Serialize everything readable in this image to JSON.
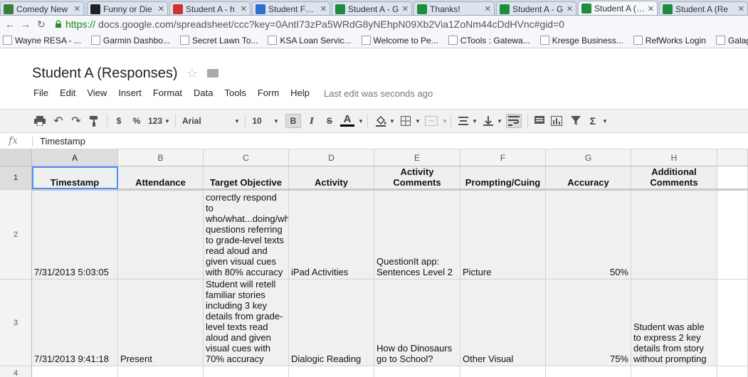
{
  "browser": {
    "tabs": [
      {
        "label": "Comedy New",
        "icon": "h-icon",
        "color": "#3a7d3a",
        "active": false
      },
      {
        "label": "Funny or Die",
        "icon": "funny-or-die-icon",
        "color": "#222222",
        "active": false
      },
      {
        "label": "Student A - h",
        "icon": "gmail-icon",
        "color": "#cc3333",
        "active": false
      },
      {
        "label": "Student Form",
        "icon": "drive-icon",
        "color": "#2f6fd1",
        "active": false
      },
      {
        "label": "Student A - G",
        "icon": "sheets-icon",
        "color": "#1e8e3e",
        "active": false
      },
      {
        "label": "Thanks!",
        "icon": "sheets-icon",
        "color": "#1e8e3e",
        "active": false
      },
      {
        "label": "Student A - G",
        "icon": "sheets-icon",
        "color": "#1e8e3e",
        "active": false
      },
      {
        "label": "Student A (Re",
        "icon": "sheets-icon",
        "color": "#1e8e3e",
        "active": true
      },
      {
        "label": "Student A (Re",
        "icon": "sheets-icon",
        "color": "#1e8e3e",
        "active": false
      }
    ],
    "url_scheme": "https://",
    "url_rest": "docs.google.com/spreadsheet/ccc?key=0AntI73zPa5WRdG8yNEhpN09Xb2Via1ZoNm44cDdHVnc#gid=0",
    "bookmarks": [
      "Wayne RESA - ...",
      "Garmin Dashbo...",
      "Secret Lawn To...",
      "KSA Loan Servic...",
      "Welcome to Pe...",
      "CTools : Gatewa...",
      "Kresge Business...",
      "RefWorks Login",
      "Galaga Game -"
    ]
  },
  "doc": {
    "title": "Student A (Responses)",
    "menu": [
      "File",
      "Edit",
      "View",
      "Insert",
      "Format",
      "Data",
      "Tools",
      "Form",
      "Help"
    ],
    "last_edit": "Last edit was seconds ago"
  },
  "toolbar": {
    "currency": "$",
    "percent": "%",
    "more_formats": "123",
    "font": "Arial",
    "font_size": "10",
    "bold": "B",
    "italic": "I",
    "strike": "S",
    "text_color": "A",
    "sigma": "Σ"
  },
  "formula_bar": {
    "fx": "fx",
    "value": "Timestamp"
  },
  "sheet": {
    "columns": [
      "A",
      "B",
      "C",
      "D",
      "E",
      "F",
      "G",
      "H"
    ],
    "row_numbers": [
      "1",
      "2",
      "3",
      "4"
    ],
    "header": [
      "Timestamp",
      "Attendance",
      "Target Objective",
      "Activity",
      "Activity Comments",
      "Prompting/Cuing",
      "Accuracy",
      "Additional Comments"
    ],
    "rows": [
      [
        "7/31/2013 5:03:05",
        "",
        "Student will correctly respond to who/what...doing/whe questions referring to grade-level texts read aloud and given visual cues with 80% accuracy",
        "iPad Activities",
        "QuestionIt app: Sentences Level 2",
        "Picture",
        "50%",
        ""
      ],
      [
        "7/31/2013 9:41:18",
        "Present",
        "Student will retell familiar stories including 3 key details from grade-level texts read aloud and given visual cues with 70% accuracy",
        "Dialogic Reading",
        "How do Dinosaurs go to School?",
        "Other Visual",
        "75%",
        "Student was able to express 2 key details from story without prompting"
      ]
    ]
  }
}
